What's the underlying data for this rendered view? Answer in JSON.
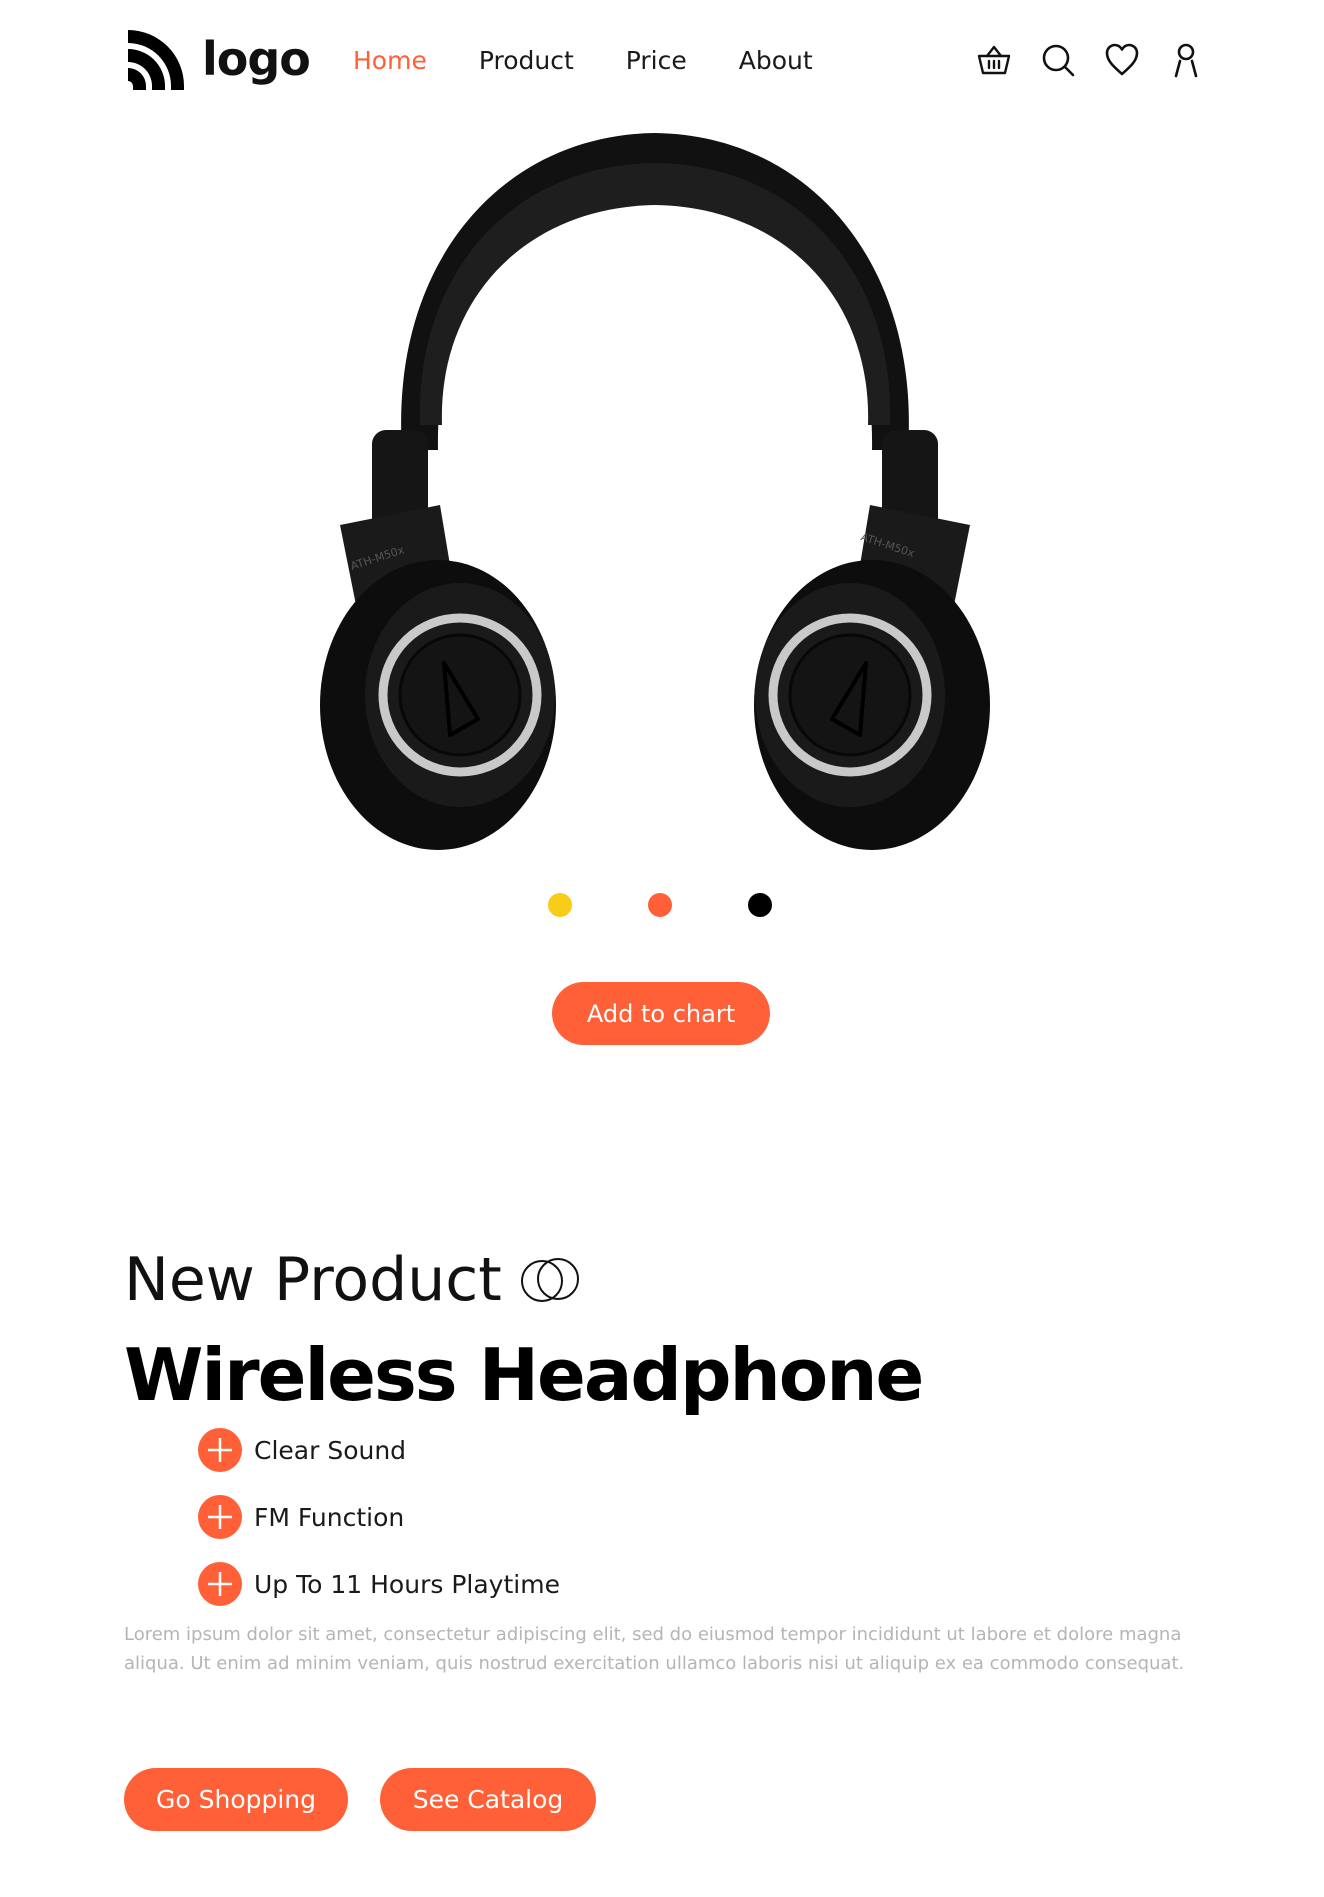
{
  "header": {
    "logo_text": "logo",
    "nav": [
      "Home",
      "Product",
      "Price",
      "About"
    ],
    "active_nav": "Home",
    "icons": [
      "basket-icon",
      "search-icon",
      "heart-icon",
      "user-icon"
    ]
  },
  "hero": {
    "image": "over-ear-headphones",
    "color_options": [
      "#F9CC1A",
      "#FF6038",
      "#000000"
    ],
    "add_button": "Add to chart",
    "earcup_text": "ATH-M50x"
  },
  "product": {
    "subtitle": "New Product",
    "title": "Wireless Headphone",
    "features": [
      "Clear Sound",
      "FM Function",
      "Up To 11 Hours Playtime"
    ],
    "description": "Lorem ipsum dolor sit amet, consectetur adipiscing elit, sed do eiusmod tempor incididunt ut labore et dolore magna aliqua. Ut enim ad minim veniam, quis nostrud exercitation ullamco laboris nisi ut aliquip ex ea commodo consequat.",
    "buttons": {
      "go_shopping": "Go Shopping",
      "see_catalog": "See Catalog"
    }
  },
  "colors": {
    "accent": "#FF6038",
    "muted_text": "#b5b5b5"
  }
}
